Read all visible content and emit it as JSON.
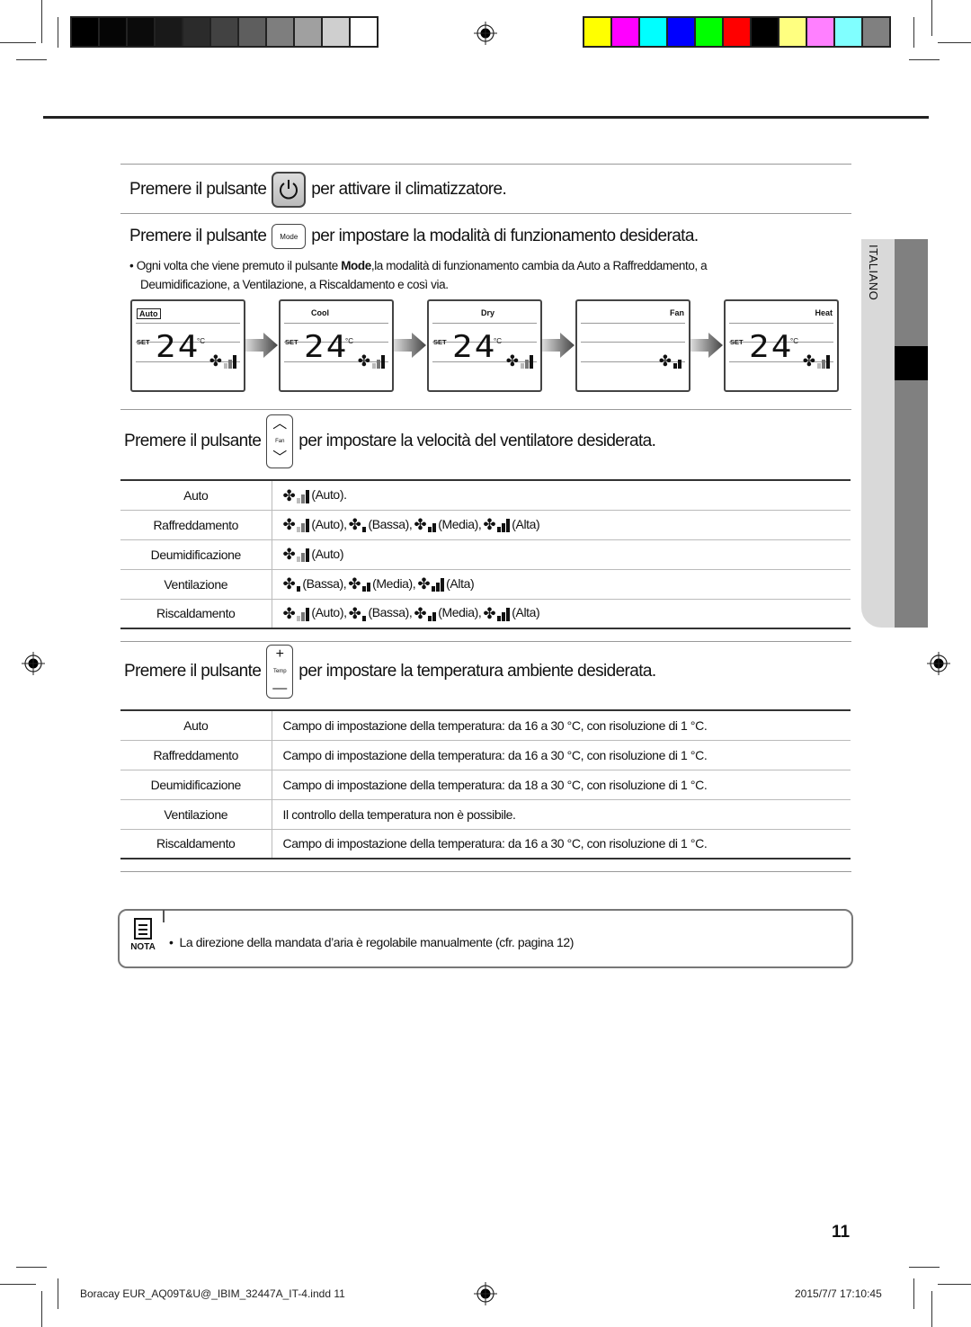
{
  "print_marks": {
    "grayscale_swatches": [
      "#000000",
      "#050505",
      "#0b0b0b",
      "#191919",
      "#2b2b2b",
      "#424242",
      "#5e5e5e",
      "#7e7e7e",
      "#a0a0a0",
      "#cfcfcf",
      "#ffffff"
    ],
    "color_swatches": [
      "#ffff00",
      "#ff00ff",
      "#00ffff",
      "#0000ff",
      "#00ff00",
      "#ff0000",
      "#000000",
      "#ffff80",
      "#ff80ff",
      "#80ffff",
      "#808080"
    ]
  },
  "sections": {
    "power": {
      "prefix": "Premere il pulsante",
      "suffix": "per attivare il climatizzatore.",
      "button_icon": "power-icon"
    },
    "mode": {
      "prefix": "Premere il pulsante",
      "button_label": "Mode",
      "suffix": "per impostare la modalità di funzionamento desiderata.",
      "bullet": "•",
      "description_before": "Ogni volta che viene premuto il pulsante ",
      "description_bold": "Mode",
      "description_after": ",la modalità di funzionamento cambia da Auto a Raffreddamento, a",
      "description_line2": "Deumidificazione, a Ventilazione, a Riscaldamento e così via.",
      "displays": [
        {
          "mode": "Auto",
          "set": "SET",
          "temp": "24",
          "unit": "°C",
          "fan": "auto"
        },
        {
          "mode": "Cool",
          "set": "SET",
          "temp": "24",
          "unit": "°C",
          "fan": "auto"
        },
        {
          "mode": "Dry",
          "set": "SET",
          "temp": "24",
          "unit": "°C",
          "fan": "auto"
        },
        {
          "mode": "Fan",
          "set": "",
          "temp": "",
          "unit": "",
          "fan": "medium"
        },
        {
          "mode": "Heat",
          "set": "SET",
          "temp": "24",
          "unit": "°C",
          "fan": "auto"
        }
      ]
    },
    "fan": {
      "prefix": "Premere il pulsante",
      "button_label": "Fan",
      "button_up": "︿",
      "button_down": "﹀",
      "suffix": "per impostare la velocità del ventilatore  desiderata.",
      "rows": [
        {
          "mode": "Auto",
          "speeds": [
            {
              "icon": "auto",
              "label": "(Auto)."
            }
          ]
        },
        {
          "mode": "Raffreddamento",
          "speeds": [
            {
              "icon": "auto",
              "label": "(Auto),"
            },
            {
              "icon": "low",
              "label": "(Bassa),"
            },
            {
              "icon": "medium",
              "label": "(Media),"
            },
            {
              "icon": "high",
              "label": "(Alta)"
            }
          ]
        },
        {
          "mode": "Deumidificazione",
          "speeds": [
            {
              "icon": "auto",
              "label": "(Auto)"
            }
          ]
        },
        {
          "mode": "Ventilazione",
          "speeds": [
            {
              "icon": "low",
              "label": "(Bassa),"
            },
            {
              "icon": "medium",
              "label": "(Media),"
            },
            {
              "icon": "high",
              "label": "(Alta)"
            }
          ]
        },
        {
          "mode": "Riscaldamento",
          "speeds": [
            {
              "icon": "auto",
              "label": "(Auto),"
            },
            {
              "icon": "low",
              "label": "(Bassa),"
            },
            {
              "icon": "medium",
              "label": "(Media),"
            },
            {
              "icon": "high",
              "label": "(Alta)"
            }
          ]
        }
      ]
    },
    "temp": {
      "prefix": "Premere il pulsante",
      "button_label": "Temp",
      "button_up": "+",
      "button_down": "—",
      "suffix": "per impostare la temperatura ambiente  desiderata.",
      "rows": [
        {
          "mode": "Auto",
          "text": "Campo di impostazione della temperatura: da 16 a 30 °C, con risoluzione  di 1 °C."
        },
        {
          "mode": "Raffreddamento",
          "text": "Campo di impostazione della temperatura: da 16 a 30 °C, con risoluzione  di 1 °C."
        },
        {
          "mode": "Deumidificazione",
          "text": "Campo di impostazione della temperatura: da 18 a 30 °C, con risoluzione  di 1 °C."
        },
        {
          "mode": "Ventilazione",
          "text": "Il controllo della temperatura non è possibile."
        },
        {
          "mode": "Riscaldamento",
          "text": "Campo di impostazione della temperatura: da 16 a 30 °C, con risoluzione  di 1 °C."
        }
      ]
    }
  },
  "note": {
    "label": "NOTA",
    "bullet": "•",
    "text": "La direzione della  mandata d’aria è regolabile manualmente (cfr. pagina 12)"
  },
  "side_tab": {
    "label": "ITALIANO"
  },
  "page_number": "11",
  "slug": {
    "file": "Boracay EUR_AQ09T&U@_IBIM_32447A_IT-4.indd   11",
    "date": "2015/7/7   17:10:45"
  }
}
